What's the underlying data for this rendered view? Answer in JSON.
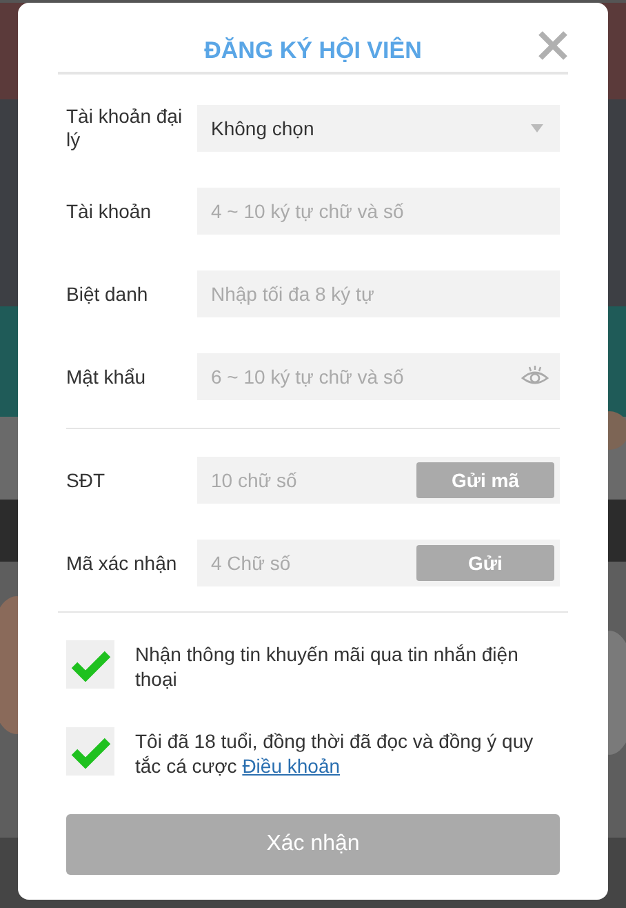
{
  "dialog": {
    "title": "ĐĂNG KÝ HỘI VIÊN"
  },
  "groups": [
    {
      "fields": [
        {
          "kind": "select",
          "label": "Tài khoản đại lý",
          "value": "Không chọn"
        },
        {
          "kind": "text",
          "label": "Tài khoản",
          "placeholder": "4 ~ 10 ký tự chữ và số"
        },
        {
          "kind": "text",
          "label": "Biệt danh",
          "placeholder": "Nhập tối đa 8 ký tự"
        },
        {
          "kind": "password",
          "label": "Mật khẩu",
          "placeholder": "6 ~ 10 ký tự chữ và số"
        }
      ]
    },
    {
      "fields": [
        {
          "kind": "code",
          "label": "SĐT",
          "placeholder": "10 chữ số",
          "button": "Gửi mã"
        },
        {
          "kind": "code",
          "label": "Mã xác nhận",
          "placeholder": "4 Chữ số",
          "button": "Gửi"
        }
      ]
    }
  ],
  "agreements": [
    {
      "text": "Nhận thông tin khuyến mãi qua tin nhắn điện thoại",
      "checked": true
    },
    {
      "text": "Tôi đã 18 tuổi, đồng thời đã đọc và đồng ý quy tắc cá cược",
      "link": "Điều khoản",
      "checked": true
    }
  ],
  "submit": {
    "label": "Xác nhận",
    "disabled": true
  }
}
